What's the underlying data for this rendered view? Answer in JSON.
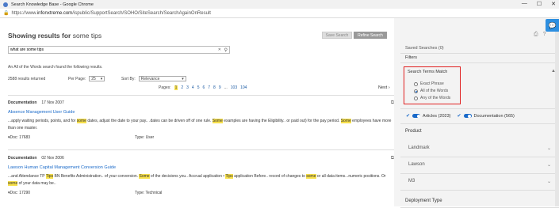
{
  "browser": {
    "title": "Search Knowledge Base - Google Chrome",
    "url_prefix": "https://www.",
    "url_host": "infonxtreme.com",
    "url_path": "/ispublic/SupportSearch/SOHO/SiteSearch/SearchAgainOnResult",
    "btn_min": "—",
    "btn_max": "☐",
    "btn_close": "✕"
  },
  "header": {
    "title_prefix": "Showing results for",
    "query": "some tips",
    "save_search": "Save Search",
    "refine_search": "Refine Search"
  },
  "search": {
    "value": "what are some tips",
    "clear": "✕"
  },
  "summary": {
    "found_text": "An All of the Words search found the following results.",
    "results_returned": "2588 results returned",
    "per_page_label": "Per Page:",
    "per_page_value": "25",
    "sort_by_label": "Sort By:",
    "sort_by_value": "Relevance",
    "pages_label": "Pages:",
    "pages": [
      "1",
      "2",
      "3",
      "4",
      "5",
      "6",
      "7",
      "8",
      "9",
      "...",
      "103",
      "104"
    ],
    "next": "Next"
  },
  "results": [
    {
      "type": "Documentation",
      "date": "17 Nov 2007",
      "title": "Absence Management User Guide",
      "snippet": [
        {
          "t": "...apply waiting periods, points, and for ",
          "h": false
        },
        {
          "t": "some",
          "h": true
        },
        {
          "t": " dates, adjust the date to your pay.. .dates can be driven off of one rule. ",
          "h": false
        },
        {
          "t": "Some",
          "h": true
        },
        {
          "t": " examples are having the Eligibility.. or paid out) for the pay period. ",
          "h": false
        },
        {
          "t": "Some",
          "h": true
        },
        {
          "t": " employees have more than one master.",
          "h": false
        }
      ],
      "doc_id": "Doc: 17683",
      "doc_type": "Type: User"
    },
    {
      "type": "Documentation",
      "date": "02 Nov 2006",
      "title": "Lawson Human Capital Management Conversion Guide",
      "snippet": [
        {
          "t": "...and Attendance TP ",
          "h": false
        },
        {
          "t": "Tips",
          "h": true
        },
        {
          "t": " BN Benefits Administration.. of your conversion. ",
          "h": false
        },
        {
          "t": "Some",
          "h": true
        },
        {
          "t": " of the decisions you.. Accrual application • ",
          "h": false
        },
        {
          "t": "Tips",
          "h": true
        },
        {
          "t": " application Before.. record of changes to ",
          "h": false
        },
        {
          "t": "some",
          "h": true
        },
        {
          "t": " or all data items...numeric positions. Or ",
          "h": false
        },
        {
          "t": "some",
          "h": true
        },
        {
          "t": " of your data may be..",
          "h": false
        }
      ],
      "doc_id": "Doc: 17290",
      "doc_type": "Type: Technical"
    }
  ],
  "sidebar": {
    "saved_searches": "Saved Searches (0)",
    "filters": "Filters",
    "terms_title": "Search Terms Match",
    "terms_options": [
      {
        "label": "Exact Phrase",
        "selected": false
      },
      {
        "label": "All of the Words",
        "selected": true
      },
      {
        "label": "Any of the Words",
        "selected": false
      }
    ],
    "articles": "Articles (2023)",
    "documentation": "Documentation (565)",
    "product_heading": "Product",
    "products": [
      "Landmark",
      "Lawson",
      "M3"
    ],
    "deployment_heading": "Deployment Type",
    "accent": "#1a6ac9",
    "highlight": "#f7e04b",
    "box_border": "#e02020"
  }
}
